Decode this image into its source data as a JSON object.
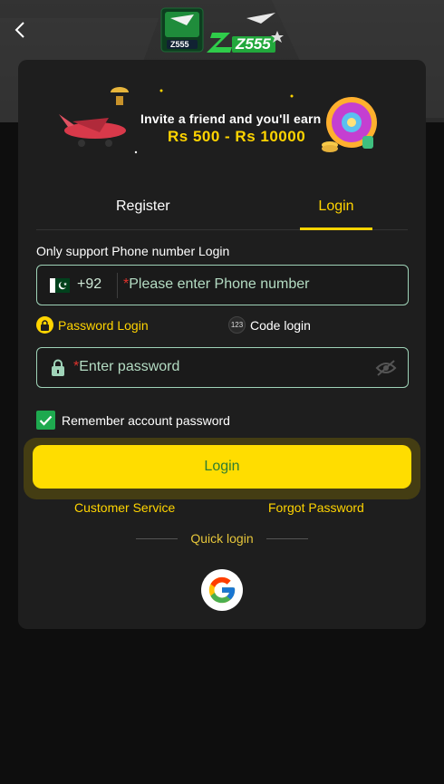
{
  "header": {
    "back_icon": "chevron-left-icon",
    "logo_text": "Z555"
  },
  "banner": {
    "line1": "Invite a friend and you'll earn",
    "line2": "Rs 500 - Rs 10000"
  },
  "tabs": [
    {
      "label": "Register",
      "active": false
    },
    {
      "label": "Login",
      "active": true
    }
  ],
  "form": {
    "hint": "Only support Phone number Login",
    "country_code": "+92",
    "flag_icon": "pakistan-flag-icon",
    "required_mark": "*",
    "phone_placeholder": "Please enter Phone number",
    "mode_password": "Password Login",
    "mode_code": "Code login",
    "mode_code_badge": "123",
    "password_placeholder": "Enter password",
    "remember_label": "Remember account password",
    "remember_checked": true,
    "login_button": "Login",
    "customer_service": "Customer Service",
    "forgot_password": "Forgot Password",
    "quick_login": "Quick login"
  },
  "colors": {
    "accent": "#ffd400",
    "button_bg": "#ffdd00",
    "button_text": "#2e7d32",
    "input_border": "#9fd3b8",
    "checkbox": "#1ea94f"
  }
}
